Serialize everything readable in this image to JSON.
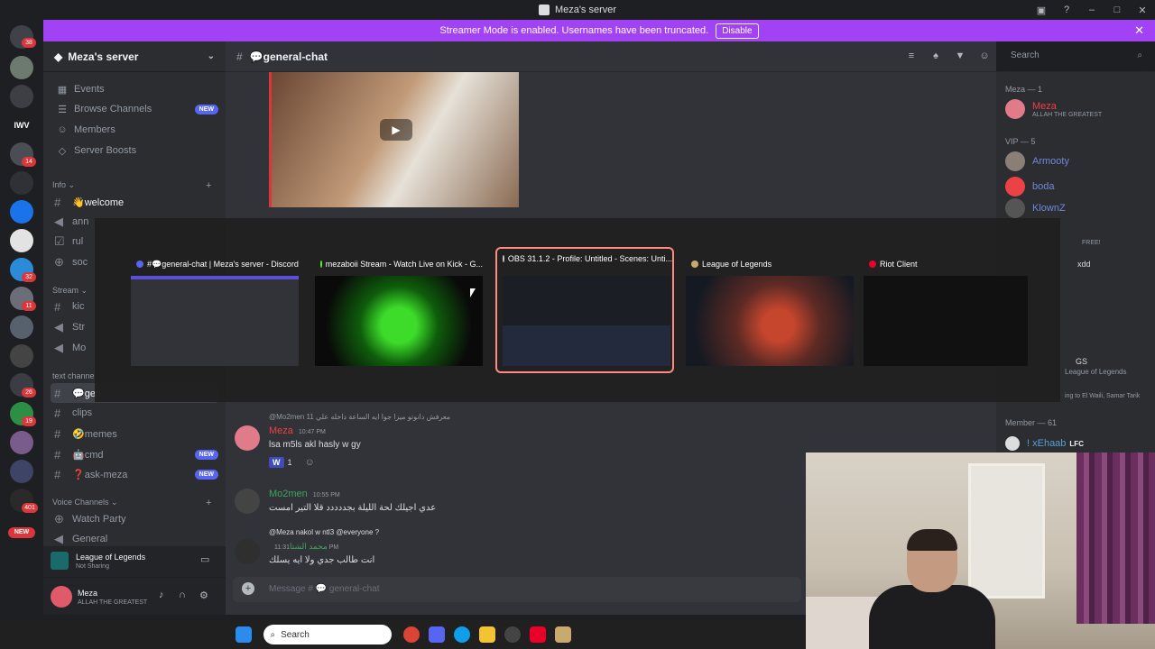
{
  "window": {
    "title": "Meza's server"
  },
  "banner": {
    "text": "Streamer Mode is enabled. Usernames have been truncated.",
    "disable_label": "Disable"
  },
  "guilds": {
    "badges": [
      "38",
      "14",
      "32",
      "11",
      "26",
      "19",
      "401"
    ],
    "new_label": "NEW",
    "labels": [
      "IWV"
    ]
  },
  "server": {
    "name": "Meza's server"
  },
  "nav": [
    {
      "label": "Events",
      "icon": "calendar-icon"
    },
    {
      "label": "Browse Channels",
      "icon": "browse-icon",
      "badge": "NEW"
    },
    {
      "label": "Members",
      "icon": "members-icon"
    },
    {
      "label": "Server Boosts",
      "icon": "boost-icon"
    }
  ],
  "categories": {
    "info": "Info",
    "stream": "Stream",
    "text": "text channe",
    "voice": "Voice Channels"
  },
  "channels": {
    "welcome": "👋welcome",
    "ann": "ann",
    "rul": "rul",
    "soc": "soc",
    "kic": "kic",
    "str": "Str",
    "mo": "Mo",
    "gen": "💬gen",
    "clips": "clips",
    "memes": "🤣memes",
    "cmd": "🤖cmd",
    "ask": "❓ask-meza",
    "watch": "Watch Party",
    "general": "General"
  },
  "chat": {
    "channel": "💬general-chat",
    "placeholder": "Message # 💬 general-chat"
  },
  "search": {
    "placeholder": "Search"
  },
  "activity": {
    "title": "League of Legends",
    "subtitle": "Not Sharing"
  },
  "user": {
    "name": "Meza",
    "status": "ALLAH THE GREATEST"
  },
  "members": {
    "meza_header": "Meza — 1",
    "meza_name": "Meza",
    "meza_status": "ALLAH THE GREATEST",
    "vip_header": "VIP — 5",
    "vip": [
      "Armooty",
      "boda",
      "KlownZ"
    ],
    "free": "FREE!",
    "xdd": "xdd",
    "gs": "GS",
    "league": "League of Legends",
    "listen": "ing to El Waili, Samar Tarik",
    "member_header": "Member — 61",
    "xehaab": "! xEhaab",
    "lfc": "LFC"
  },
  "alt_tab": [
    {
      "title": "#💬general-chat | Meza's server - Discord"
    },
    {
      "title": "mezaboii Stream - Watch Live on Kick - G..."
    },
    {
      "title": "OBS 31.1.2 - Profile: Untitled - Scenes: Unti..."
    },
    {
      "title": "League of Legends"
    },
    {
      "title": "Riot Client"
    }
  ],
  "messages": [
    {
      "reply": "@Mo2men معرفش دانوتو ميزا جوا ايه الساعة داخله علي 11",
      "author": "Meza",
      "time": "10:47 PM",
      "text": "lsa m5ls akl hasly w gy",
      "reaction": "1"
    },
    {
      "author": "Mo2men",
      "time": "10:55 PM",
      "text": "عدي اجيلك لحة الليلة بجددددد قلا التير امست"
    },
    {
      "reply": "@Meza nakol w ntl3 @everyone ?",
      "author": "محمد الشتا",
      "time": "11:31 PM",
      "text": "انت طالب جدي ولا ايه يسلك"
    }
  ],
  "taskbar": {
    "search": "Search"
  }
}
